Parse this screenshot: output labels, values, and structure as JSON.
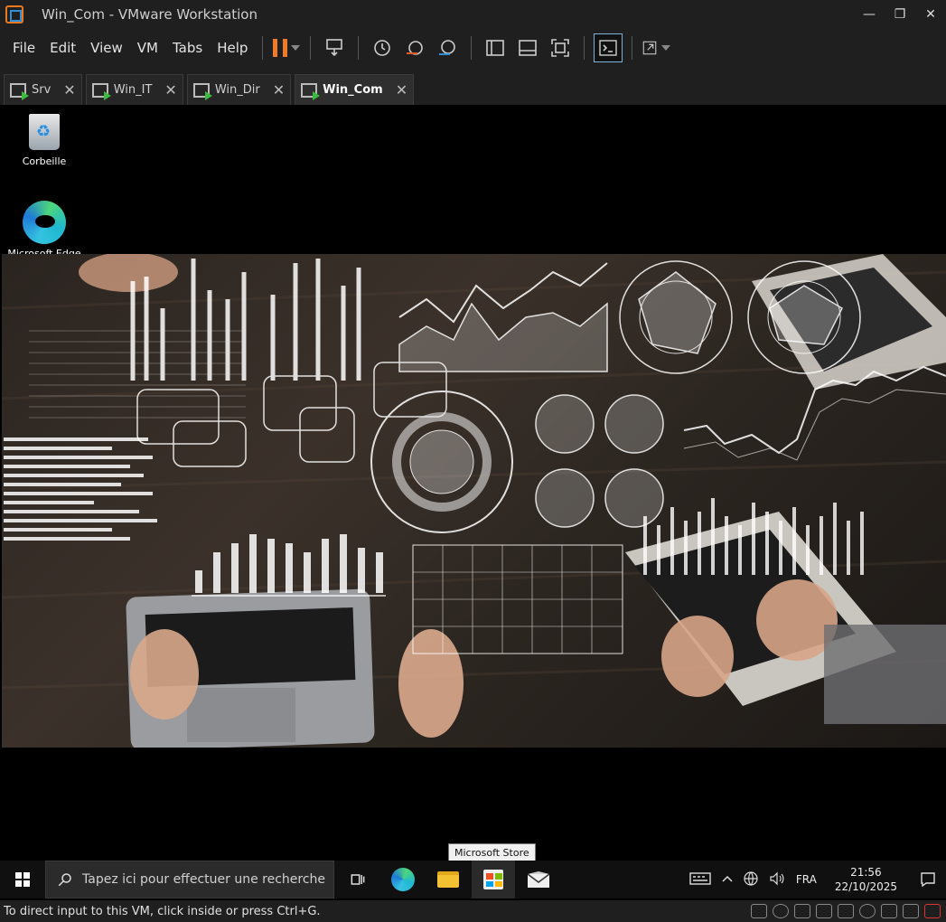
{
  "window": {
    "title": "Win_Com - VMware Workstation",
    "minimize": "—",
    "restore": "❐",
    "close": "✕"
  },
  "menu": [
    "File",
    "Edit",
    "View",
    "VM",
    "Tabs",
    "Help"
  ],
  "tabs": [
    {
      "label": "Srv",
      "active": false
    },
    {
      "label": "Win_IT",
      "active": false
    },
    {
      "label": "Win_Dir",
      "active": false
    },
    {
      "label": "Win_Com",
      "active": true
    }
  ],
  "desktop": {
    "icons": [
      {
        "label": "Corbeille"
      },
      {
        "label": "Microsoft Edge"
      }
    ]
  },
  "taskbar": {
    "search_placeholder": "Tapez ici pour effectuer une recherche",
    "tooltip": "Microsoft Store",
    "language": "FRA",
    "time": "21:56",
    "date": "22/10/2025"
  },
  "statusbar": {
    "message": "To direct input to this VM, click inside or press Ctrl+G."
  }
}
